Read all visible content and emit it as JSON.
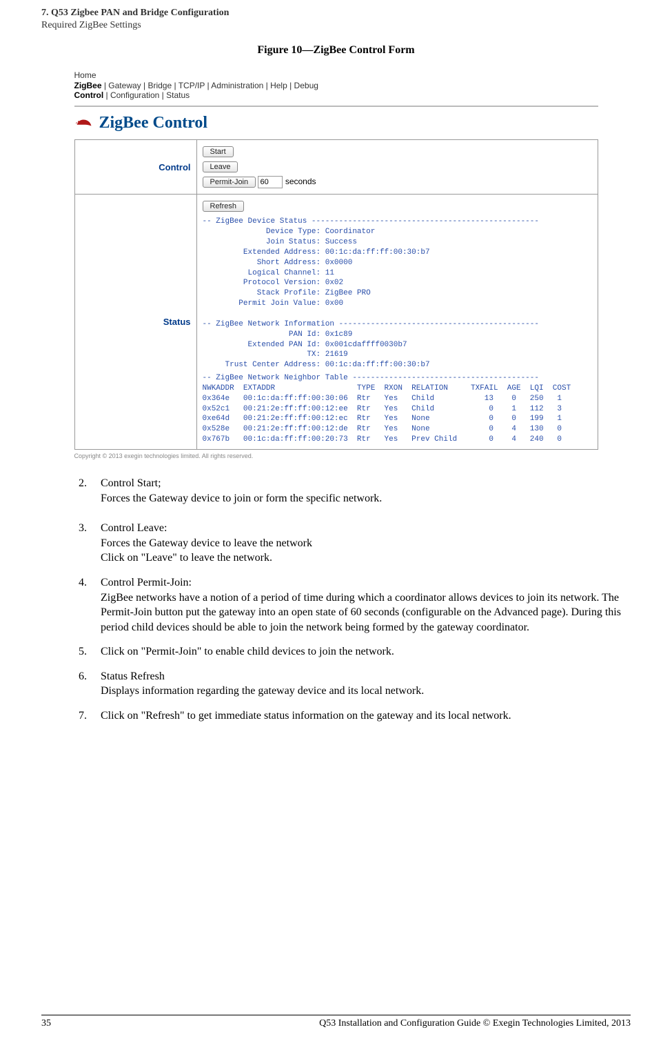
{
  "header": {
    "chapter_line": "7. Q53 Zigbee PAN and Bridge Configuration",
    "section_line": "Required ZigBee Settings"
  },
  "figure_title": "Figure 10—ZigBee Control Form",
  "screenshot": {
    "nav": {
      "home": "Home",
      "row2": {
        "active": "ZigBee",
        "rest": " | Gateway | Bridge | TCP/IP | Administration | Help | Debug"
      },
      "row3": {
        "active": "Control",
        "rest": " | Configuration | Status"
      }
    },
    "title": "ZigBee Control",
    "control": {
      "label": "Control",
      "start_btn": "Start",
      "leave_btn": "Leave",
      "permit_btn": "Permit-Join",
      "permit_value": "60",
      "permit_suffix": "seconds"
    },
    "status": {
      "label": "Status",
      "refresh_btn": "Refresh",
      "device_status_text": "-- ZigBee Device Status --------------------------------------------------\n              Device Type: Coordinator\n              Join Status: Success\n         Extended Address: 00:1c:da:ff:ff:00:30:b7\n            Short Address: 0x0000\n          Logical Channel: 11\n         Protocol Version: 0x02\n            Stack Profile: ZigBee PRO\n        Permit Join Value: 0x00\n\n-- ZigBee Network Information --------------------------------------------\n                   PAN Id: 0x1c89\n          Extended PAN Id: 0x001cdaffff0030b7\n                       TX: 21619\n     Trust Center Address: 00:1c:da:ff:ff:00:30:b7",
      "neighbor_table_text": "-- ZigBee Network Neighbor Table -----------------------------------------\nNWKADDR  EXTADDR                  TYPE  RXON  RELATION     TXFAIL  AGE  LQI  COST\n0x364e   00:1c:da:ff:ff:00:30:06  Rtr   Yes   Child           13    0   250   1\n0x52c1   00:21:2e:ff:ff:00:12:ee  Rtr   Yes   Child            0    1   112   3\n0xe64d   00:21:2e:ff:ff:00:12:ec  Rtr   Yes   None             0    0   199   1\n0x528e   00:21:2e:ff:ff:00:12:de  Rtr   Yes   None             0    4   130   0\n0x767b   00:1c:da:ff:ff:00:20:73  Rtr   Yes   Prev Child       0    4   240   0"
    },
    "copyright": "Copyright © 2013 exegin technologies limited. All rights reserved."
  },
  "list": {
    "i2": {
      "num": "2.",
      "title": "Control Start;",
      "body": "Forces the Gateway device to join or form the specific network."
    },
    "i3": {
      "num": "3.",
      "title": "Control Leave:",
      "body1": "Forces the Gateway device to leave the network",
      "body2": "Click on \"Leave\" to leave the network."
    },
    "i4": {
      "num": "4.",
      "title": "Control Permit-Join:",
      "body": "ZigBee networks have a notion of a period of time during which a coordinator allows devices to join its network. The Permit-Join button put the gateway into an open state of 60 seconds (configurable on the Advanced page). During this period child devices should be able to join the network being formed by the gateway coordinator."
    },
    "i5": {
      "num": "5.",
      "body": "Click on \"Permit-Join\" to enable child devices to join the network."
    },
    "i6": {
      "num": "6.",
      "title": "Status Refresh",
      "body": "Displays information regarding the gateway device and its local network."
    },
    "i7": {
      "num": "7.",
      "body": "Click on \"Refresh\" to get immediate status information on the gateway and its local network."
    }
  },
  "footer": {
    "page_number": "35",
    "text": "Q53 Installation and Configuration Guide  © Exegin Technologies Limited, 2013"
  }
}
